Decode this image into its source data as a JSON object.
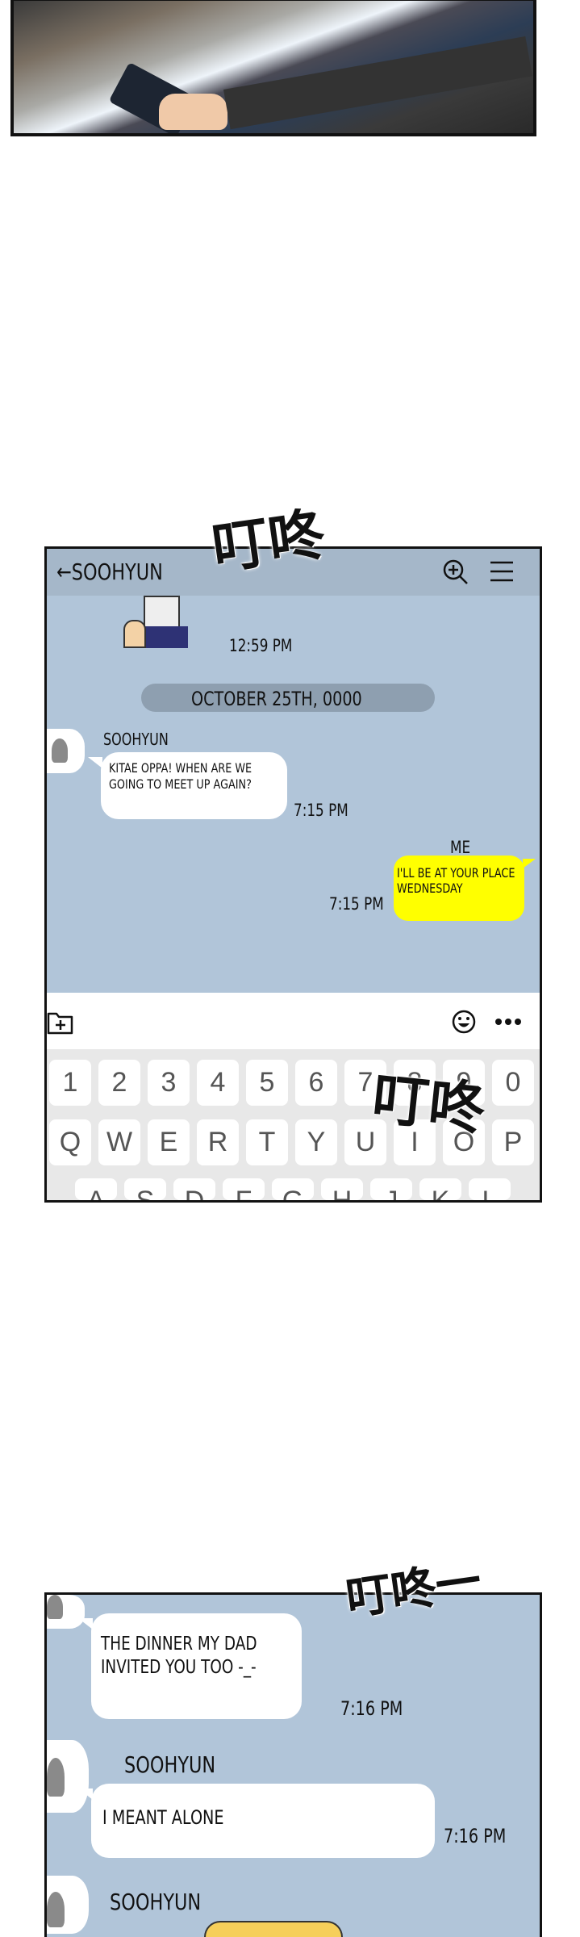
{
  "chat_screen_1": {
    "header": {
      "back_icon": "arrow-left-icon",
      "title": "SOOHYUN",
      "search_icon": "zoom-in-icon",
      "menu_icon": "hamburger-menu-icon"
    },
    "sticker_time": "12:59 PM",
    "date_divider": "OCTOBER 25TH, 0000",
    "messages": [
      {
        "sender": "SOOHYUN",
        "text_lines": [
          "KITAE OPPA! WHEN ARE WE",
          "GOING TO MEET UP AGAIN?"
        ],
        "time": "7:15 PM"
      },
      {
        "sender": "ME",
        "text_lines": [
          "I'LL BE AT YOUR PLACE",
          "WEDNESDAY"
        ],
        "time": "7:15 PM"
      }
    ],
    "input_bar": {
      "attach_icon": "folder-plus-icon",
      "emoji_icon": "smiley-icon",
      "more_icon": "ellipsis-icon"
    },
    "keyboard": {
      "row1": [
        "1",
        "2",
        "3",
        "4",
        "5",
        "6",
        "7",
        "8",
        "9",
        "0"
      ],
      "row2": [
        "Q",
        "W",
        "E",
        "R",
        "T",
        "Y",
        "U",
        "I",
        "O",
        "P"
      ],
      "row3": [
        "A",
        "S",
        "D",
        "F",
        "G",
        "H",
        "J",
        "K",
        "L"
      ]
    }
  },
  "sfx": [
    "叮咚",
    "叮咚",
    "叮咚一"
  ],
  "chat_screen_2": {
    "messages": [
      {
        "text_lines": [
          "THE DINNER MY DAD",
          "INVITED YOU TOO -_-"
        ],
        "time": "7:16 PM"
      },
      {
        "sender": "SOOHYUN",
        "text": "I MEANT ALONE",
        "time": "7:16 PM"
      },
      {
        "sender": "SOOHYUN"
      }
    ]
  },
  "colors": {
    "chat_bg": "#b1c5d9",
    "header_bg": "#a5b7c9",
    "my_bubble": "#ffff00",
    "date_pill": "#8e9fb0"
  }
}
